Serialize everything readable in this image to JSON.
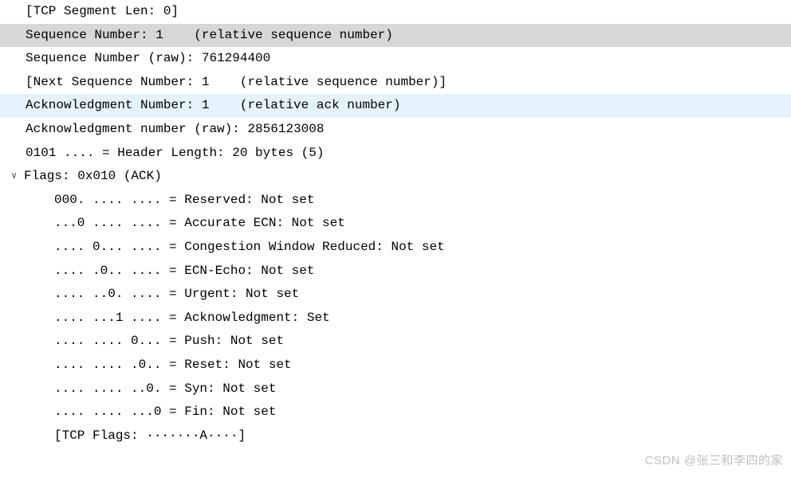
{
  "rows": {
    "seg_len": "[TCP Segment Len: 0]",
    "seq_rel": "Sequence Number: 1    (relative sequence number)",
    "seq_raw": "Sequence Number (raw): 761294400",
    "next_seq": "[Next Sequence Number: 1    (relative sequence number)]",
    "ack_rel": "Acknowledgment Number: 1    (relative ack number)",
    "ack_raw": "Acknowledgment number (raw): 2856123008",
    "hdr_len": "0101 .... = Header Length: 20 bytes (5)",
    "flags_header": "Flags: 0x010 (ACK)",
    "f_reserved": "000. .... .... = Reserved: Not set",
    "f_accurate": "...0 .... .... = Accurate ECN: Not set",
    "f_cwr": ".... 0... .... = Congestion Window Reduced: Not set",
    "f_ecn": ".... .0.. .... = ECN-Echo: Not set",
    "f_urg": ".... ..0. .... = Urgent: Not set",
    "f_ack": ".... ...1 .... = Acknowledgment: Set",
    "f_push": ".... .... 0... = Push: Not set",
    "f_reset": ".... .... .0.. = Reset: Not set",
    "f_syn": ".... .... ..0. = Syn: Not set",
    "f_fin": ".... .... ...0 = Fin: Not set",
    "tcp_flags_summary": "[TCP Flags: ·······A····]"
  },
  "watermark": "CSDN @张三和李四的家"
}
